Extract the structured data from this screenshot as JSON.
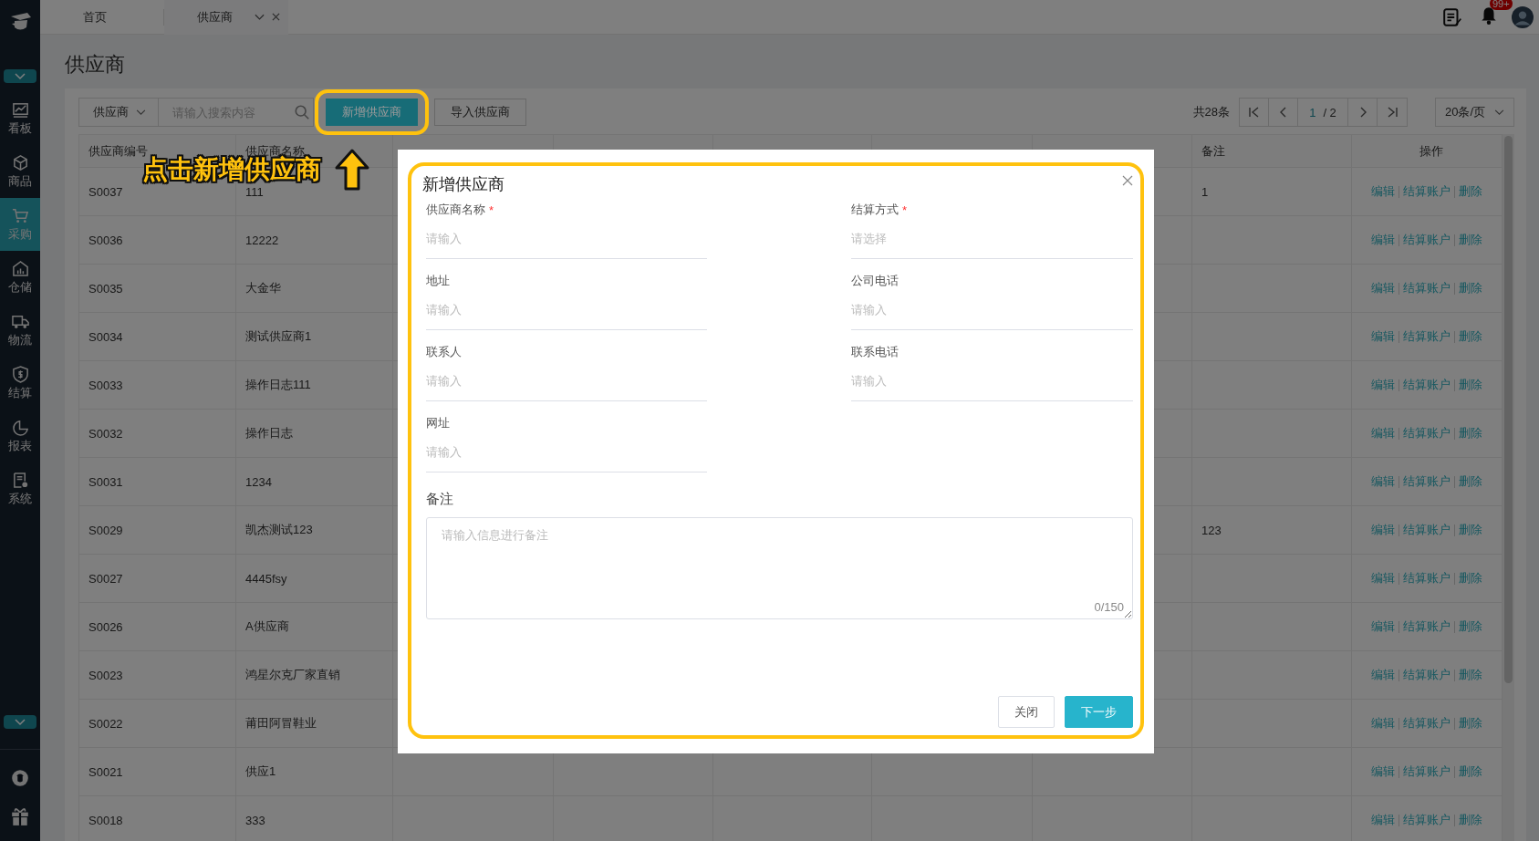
{
  "sidebar": {
    "items": [
      {
        "label": "看板",
        "selected": false
      },
      {
        "label": "商品",
        "selected": false
      },
      {
        "label": "采购",
        "selected": true
      },
      {
        "label": "仓储",
        "selected": false
      },
      {
        "label": "物流",
        "selected": false
      },
      {
        "label": "结算",
        "selected": false
      },
      {
        "label": "报表",
        "selected": false
      },
      {
        "label": "系统",
        "selected": false
      }
    ]
  },
  "tabs": [
    {
      "label": "首页",
      "selected": false,
      "closable": false
    },
    {
      "label": "供应商",
      "selected": true,
      "closable": true
    }
  ],
  "notifications": {
    "badge": "99+"
  },
  "page_title": "供应商",
  "toolbar": {
    "filter": "供应商",
    "search_placeholder": "请输入搜索内容",
    "buttons": [
      {
        "label": "新增供应商",
        "kind": "primary",
        "highlighted": true
      },
      {
        "label": "导入供应商",
        "kind": "default",
        "highlighted": false
      }
    ]
  },
  "pagination": {
    "total": "共28条",
    "page": "1",
    "pages": "/ 2",
    "page_size": "20条/页"
  },
  "table": {
    "columns": [
      "供应商编号",
      "供应商名称"
    ],
    "right_columns": [
      "备注",
      "操作"
    ],
    "rows": [
      {
        "cells": [
          "S0037",
          "111",
          "",
          "",
          "",
          "",
          "",
          "1"
        ],
        "actions": [
          "编辑",
          "结算账户",
          "删除"
        ]
      },
      {
        "cells": [
          "S0036",
          "12222",
          "",
          "",
          "",
          "",
          "",
          ""
        ],
        "actions": [
          "编辑",
          "结算账户",
          "删除"
        ]
      },
      {
        "cells": [
          "S0035",
          "大金华",
          "",
          "",
          "",
          "",
          "",
          ""
        ],
        "actions": [
          "编辑",
          "结算账户",
          "删除"
        ]
      },
      {
        "cells": [
          "S0034",
          "测试供应商1",
          "",
          "",
          "",
          "",
          "",
          ""
        ],
        "actions": [
          "编辑",
          "结算账户",
          "删除"
        ]
      },
      {
        "cells": [
          "S0033",
          "操作日志111",
          "",
          "",
          "",
          "",
          "",
          ""
        ],
        "actions": [
          "编辑",
          "结算账户",
          "删除"
        ]
      },
      {
        "cells": [
          "S0032",
          "操作日志",
          "",
          "",
          "",
          "",
          "",
          ""
        ],
        "actions": [
          "编辑",
          "结算账户",
          "删除"
        ]
      },
      {
        "cells": [
          "S0031",
          "1234",
          "",
          "",
          "",
          "",
          "",
          ""
        ],
        "actions": [
          "编辑",
          "结算账户",
          "删除"
        ]
      },
      {
        "cells": [
          "S0029",
          "凯杰测试123",
          "",
          "",
          "",
          "",
          "",
          "123"
        ],
        "actions": [
          "编辑",
          "结算账户",
          "删除"
        ]
      },
      {
        "cells": [
          "S0027",
          "4445fsy",
          "",
          "",
          "",
          "",
          "",
          ""
        ],
        "actions": [
          "编辑",
          "结算账户",
          "删除"
        ]
      },
      {
        "cells": [
          "S0026",
          "A供应商",
          "",
          "",
          "",
          "",
          "",
          ""
        ],
        "actions": [
          "编辑",
          "结算账户",
          "删除"
        ]
      },
      {
        "cells": [
          "S0023",
          "鸿星尔克厂家直销",
          "",
          "",
          "",
          "",
          "",
          ""
        ],
        "actions": [
          "编辑",
          "结算账户",
          "删除"
        ]
      },
      {
        "cells": [
          "S0022",
          "莆田阿冒鞋业",
          "",
          "",
          "",
          "",
          "",
          ""
        ],
        "actions": [
          "编辑",
          "结算账户",
          "删除"
        ]
      },
      {
        "cells": [
          "S0021",
          "供应1",
          "",
          "",
          "",
          "",
          "",
          ""
        ],
        "actions": [
          "编辑",
          "结算账户",
          "删除"
        ]
      },
      {
        "cells": [
          "S0018",
          "333",
          "",
          "",
          "",
          "",
          "",
          ""
        ],
        "actions": [
          "编辑",
          "结算账户",
          "删除"
        ]
      }
    ]
  },
  "annotation": {
    "text": "点击新增供应商"
  },
  "dialog": {
    "title": "新增供应商",
    "fields": [
      {
        "label": "供应商名称",
        "required_mark": "*",
        "placeholder": "请输入"
      },
      {
        "label": "结算方式",
        "required_mark": "*",
        "placeholder": "请选择"
      },
      {
        "label": "地址",
        "placeholder": "请输入"
      },
      {
        "label": "公司电话",
        "placeholder": "请输入"
      },
      {
        "label": "联系人",
        "placeholder": "请输入"
      },
      {
        "label": "联系电话",
        "placeholder": "请输入"
      },
      {
        "label": "网址",
        "placeholder": "请输入"
      }
    ],
    "note": {
      "label": "备注",
      "placeholder": "请输入信息进行备注",
      "counter": "0/150"
    },
    "buttons": [
      {
        "label": "关闭",
        "kind": "default"
      },
      {
        "label": "下一步",
        "kind": "primary"
      }
    ]
  }
}
